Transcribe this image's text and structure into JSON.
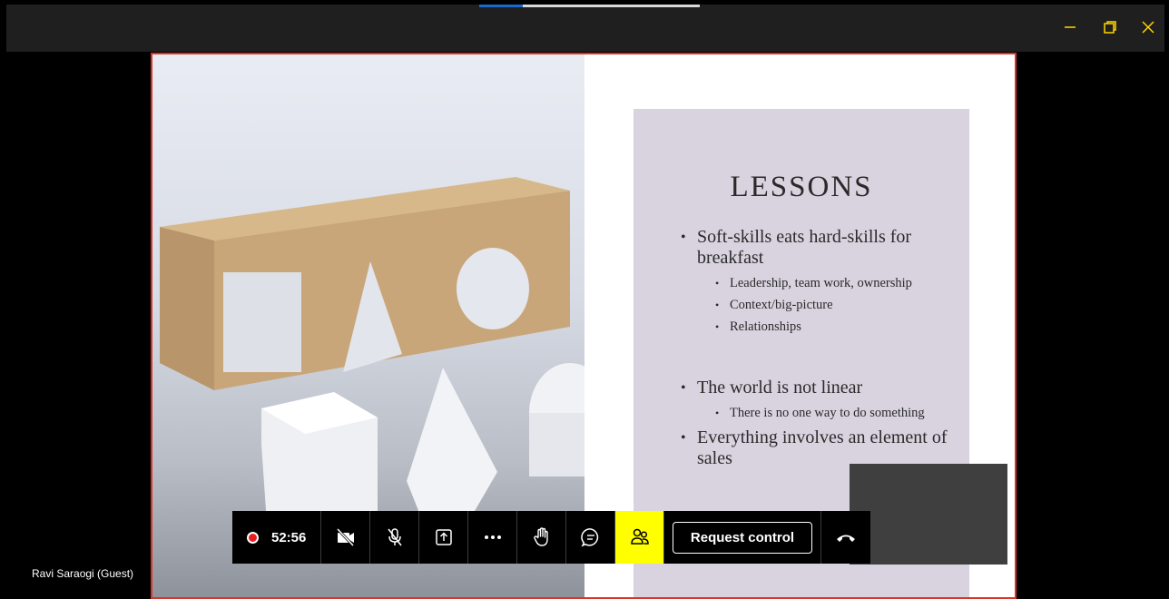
{
  "window": {
    "minimize_icon": "minimize-icon",
    "maximize_icon": "restore-icon",
    "close_icon": "close-icon",
    "accent_color": "#ffd700"
  },
  "slide": {
    "title": "LESSONS",
    "bullets": [
      "Soft-skills eats hard-skills for breakfast",
      "Leadership, team work, ownership",
      "Context/big-picture",
      "Relationships",
      "The world is not linear",
      "There is no one way to do something",
      "Everything involves an element of sales"
    ]
  },
  "toolbar": {
    "recording_time": "52:56",
    "request_control_label": "Request control",
    "participants_active_color": "#ffff00"
  },
  "participant": {
    "name": "Ravi Saraogi (Guest)"
  }
}
